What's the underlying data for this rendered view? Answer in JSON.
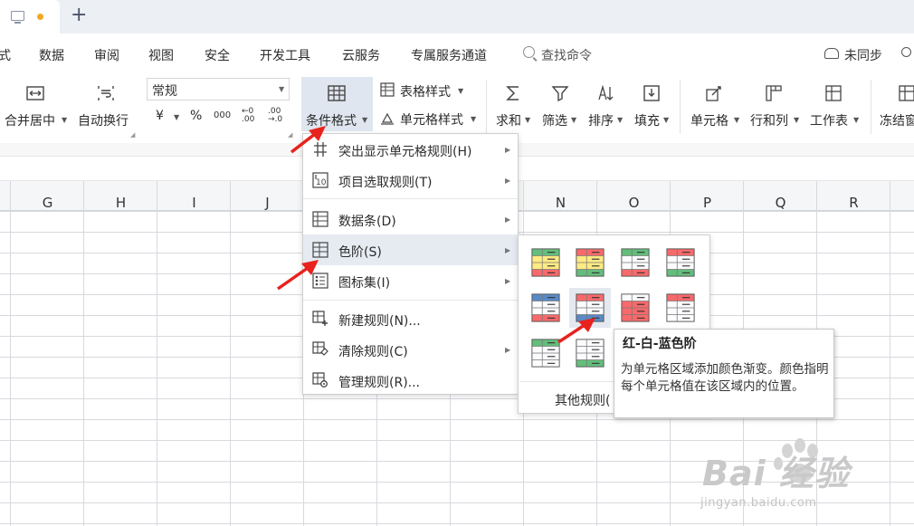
{
  "colors": {
    "accent_orange": "#f5a623",
    "menu_highlight": "#e6ebf2",
    "arrow_red": "#e8221d"
  },
  "menubar": {
    "items": [
      "式",
      "数据",
      "审阅",
      "视图",
      "安全",
      "开发工具",
      "云服务",
      "专属服务通道"
    ],
    "search_label": "查找命令",
    "sync_label": "未同步"
  },
  "ribbon": {
    "merge_label": "合并居中",
    "wrap_label": "自动换行",
    "number_format": "常规",
    "currency": "¥",
    "percent": "%",
    "thousands": "000",
    "cond_format": "条件格式",
    "table_style": "表格样式",
    "cell_style": "单元格样式",
    "sum": "求和",
    "filter": "筛选",
    "sort": "排序",
    "fill": "填充",
    "cell": "单元格",
    "rowcol": "行和列",
    "sheet": "工作表",
    "freeze": "冻结窗"
  },
  "columns": [
    "G",
    "H",
    "I",
    "J",
    "N",
    "O",
    "P",
    "Q",
    "R"
  ],
  "cf_menu": {
    "items": [
      {
        "label": "突出显示单元格规则(H)",
        "icon": "highlight-rules-icon",
        "submenu": true
      },
      {
        "label": "项目选取规则(T)",
        "icon": "top10-icon",
        "submenu": true
      },
      {
        "label": "数据条(D)",
        "icon": "databar-icon",
        "submenu": true
      },
      {
        "label": "色阶(S)",
        "icon": "colorscale-icon",
        "submenu": true
      },
      {
        "label": "图标集(I)",
        "icon": "iconset-icon",
        "submenu": true
      },
      {
        "label": "新建规则(N)...",
        "icon": "new-rule-icon",
        "submenu": false
      },
      {
        "label": "清除规则(C)",
        "icon": "clear-rule-icon",
        "submenu": true
      },
      {
        "label": "管理规则(R)...",
        "icon": "manage-rule-icon",
        "submenu": false
      }
    ]
  },
  "colorscale": {
    "swatches": [
      [
        "#63be7b",
        "#ffeb84",
        "#f8696b"
      ],
      [
        "#f8696b",
        "#ffeb84",
        "#63be7b"
      ],
      [
        "#63be7b",
        "#fcfcff",
        "#f8696b"
      ],
      [
        "#f8696b",
        "#fcfcff",
        "#63be7b"
      ],
      [
        "#5a8ac6",
        "#fcfcff",
        "#f8696b"
      ],
      [
        "#f8696b",
        "#fcfcff",
        "#5a8ac6"
      ],
      [
        "#fcfcff",
        "#f8696b",
        "#f8696b"
      ],
      [
        "#f8696b",
        "#fcfcff",
        "#fcfcff"
      ],
      [
        "#63be7b",
        "#fcfcff",
        "#fcfcff"
      ],
      [
        "#fcfcff",
        "#fcfcff",
        "#63be7b"
      ]
    ],
    "more_rules": "其他规则("
  },
  "tooltip": {
    "title": "红-白-蓝色阶",
    "body": "为单元格区域添加颜色渐变。颜色指明每个单元格值在该区域内的位置。"
  },
  "watermark": {
    "main": "Bai 经验",
    "sub": "jingyan.baidu.com"
  }
}
